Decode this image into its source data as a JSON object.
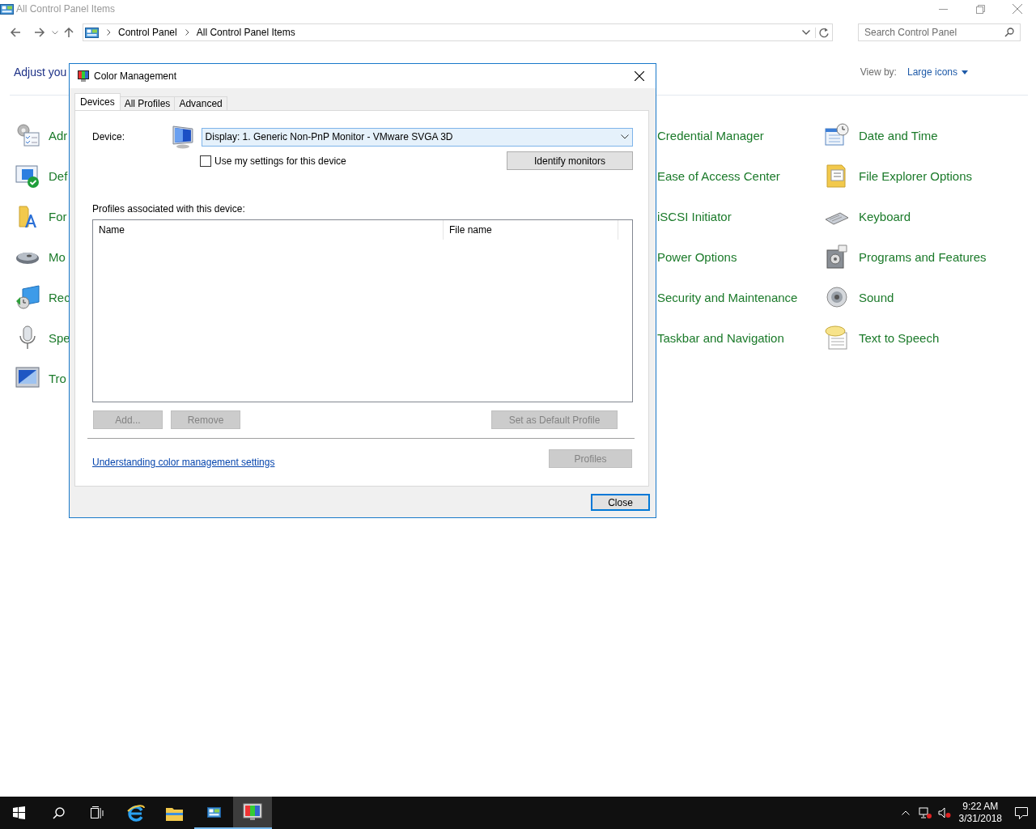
{
  "window": {
    "title": "All Control Panel Items"
  },
  "address_bar": {
    "path": [
      "Control Panel",
      "All Control Panel Items"
    ]
  },
  "search": {
    "placeholder": "Search Control Panel"
  },
  "header": {
    "heading": "Adjust you",
    "view_by_label": "View by:",
    "view_by_value": "Large icons"
  },
  "columns": [
    {
      "icons": true,
      "items": [
        "Adr",
        "Def",
        "For",
        "Mo",
        "Rec",
        "Spe",
        "Tro"
      ]
    },
    {
      "icons": false,
      "items": [
        "Credential Manager",
        "Ease of Access Center",
        "iSCSI Initiator",
        "Power Options",
        "Security and Maintenance",
        "Taskbar and Navigation"
      ]
    },
    {
      "icons": true,
      "items": [
        "Date and Time",
        "File Explorer Options",
        "Keyboard",
        "Programs and Features",
        "Sound",
        "Text to Speech"
      ]
    }
  ],
  "dialog": {
    "title": "Color Management",
    "tabs": [
      {
        "label": "Devices",
        "selected": true
      },
      {
        "label": "All Profiles",
        "selected": false
      },
      {
        "label": "Advanced",
        "selected": false
      }
    ],
    "device_label": "Device:",
    "device_value": "Display: 1. Generic Non-PnP Monitor - VMware SVGA 3D",
    "use_my_settings": {
      "label": "Use my settings for this device",
      "checked": false
    },
    "identify_button": {
      "label": "Identify monitors",
      "disabled": false
    },
    "profiles_label": "Profiles associated with this device:",
    "profile_columns": [
      "Name",
      "File name"
    ],
    "profile_buttons": [
      {
        "label": "Add...",
        "disabled": true
      },
      {
        "label": "Remove",
        "disabled": true
      },
      {
        "label": "Set as Default Profile",
        "disabled": true
      }
    ],
    "link": "Understanding color management settings",
    "profiles_button": {
      "label": "Profiles",
      "disabled": true
    },
    "close_button": "Close"
  },
  "taskbar": {
    "apps": [
      {
        "kind": "ie",
        "running": false,
        "active": false
      },
      {
        "kind": "folder",
        "running": false,
        "active": false
      },
      {
        "kind": "control_panel",
        "running": true,
        "active": false
      },
      {
        "kind": "color",
        "running": true,
        "active": true
      }
    ],
    "time": "9:22 AM",
    "date": "3/31/2018"
  }
}
